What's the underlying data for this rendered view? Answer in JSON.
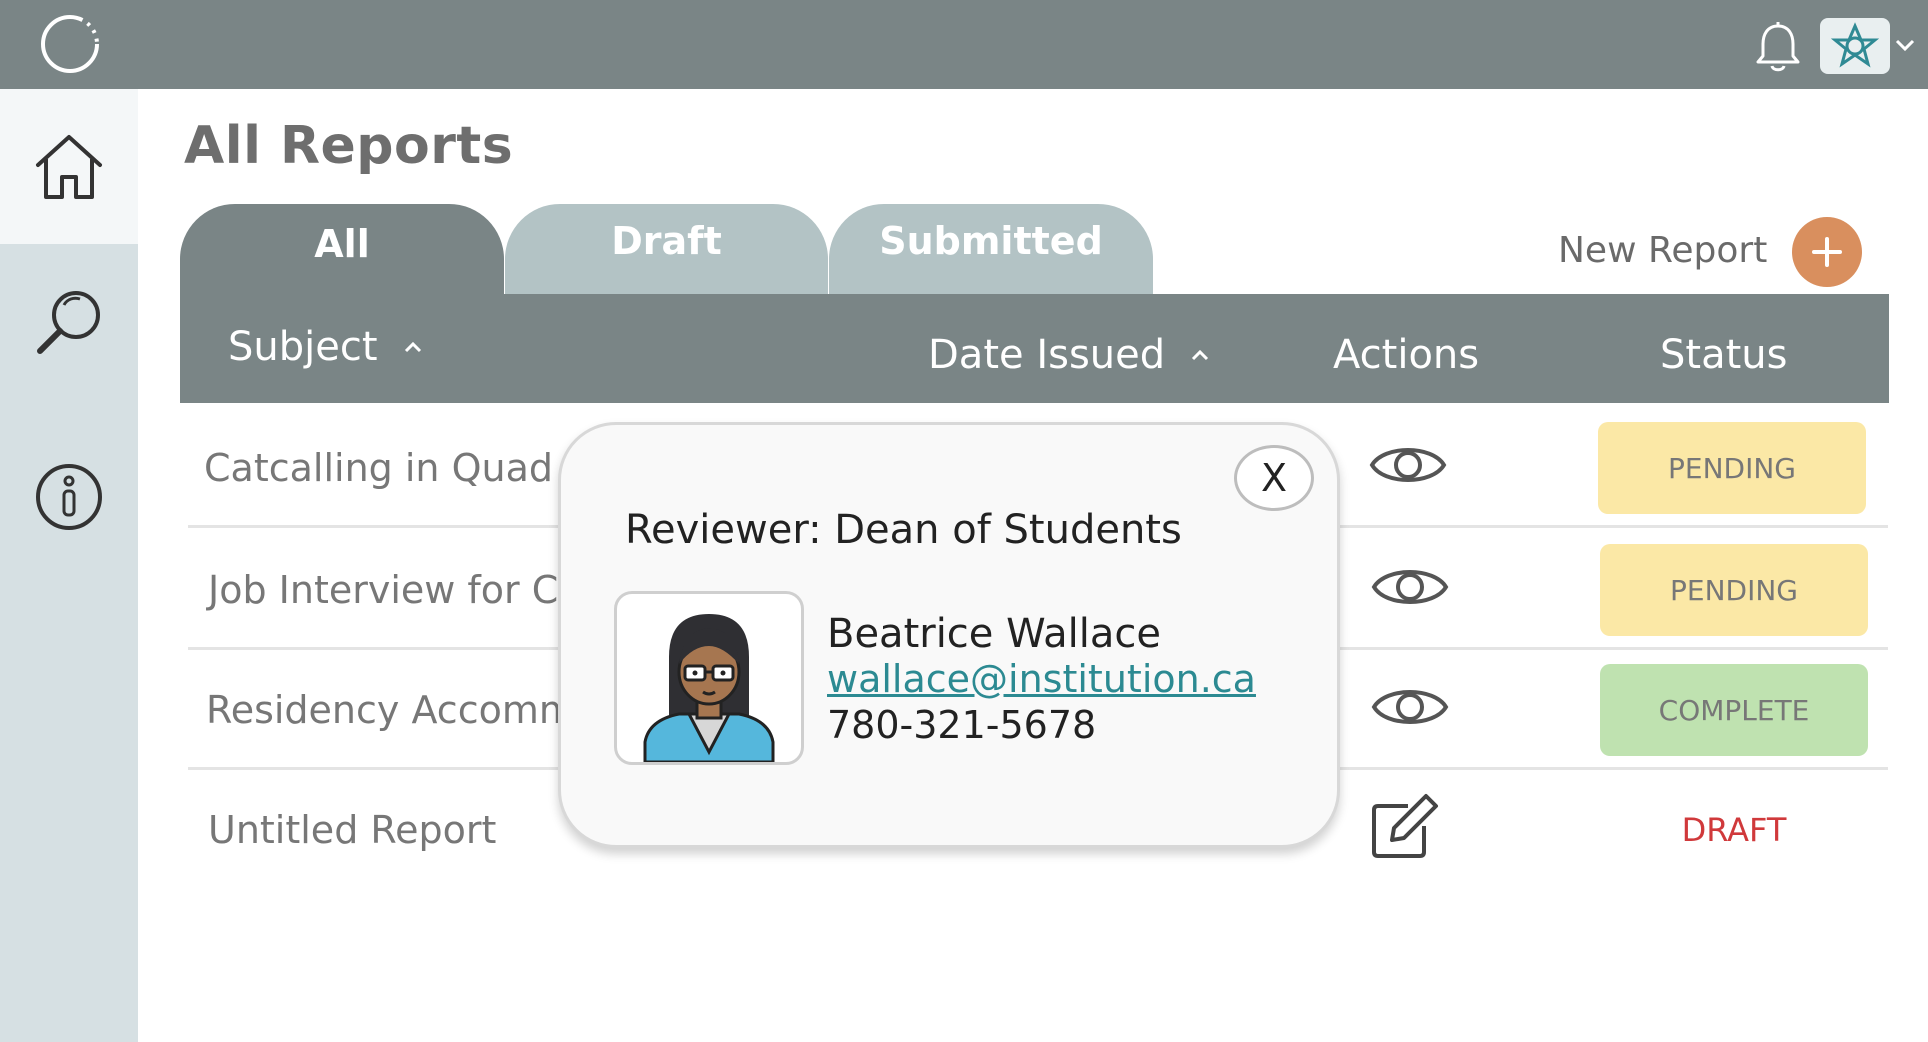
{
  "page": {
    "title": "All Reports"
  },
  "tabs": [
    {
      "label": "All",
      "active": true
    },
    {
      "label": "Draft",
      "active": false
    },
    {
      "label": "Submitted",
      "active": false
    }
  ],
  "new_report": {
    "label": "New Report"
  },
  "table": {
    "columns": {
      "subject": "Subject",
      "date_issued": "Date Issued",
      "actions": "Actions",
      "status": "Status"
    },
    "rows": [
      {
        "subject": "Catcalling in Quad",
        "action_icon": "eye-icon",
        "status": "PENDING"
      },
      {
        "subject": "Job Interview for CS",
        "action_icon": "eye-icon",
        "status": "PENDING"
      },
      {
        "subject": "Residency Accomm",
        "action_icon": "eye-icon",
        "status": "COMPLETE"
      },
      {
        "subject": "Untitled Report",
        "action_icon": "edit-icon",
        "status": "DRAFT"
      }
    ]
  },
  "popup": {
    "close_label": "X",
    "title": "Reviewer: Dean of Students",
    "name": "Beatrice Wallace",
    "email": "wallace@institution.ca",
    "phone": "780-321-5678"
  },
  "colors": {
    "header_bg": "#7a8586",
    "sidebar_bg": "#d6e0e3",
    "inactive_tab": "#b3c3c5",
    "accent_orange": "#d98f5e",
    "pending": "#fbe8a6",
    "complete": "#bfe2b0",
    "draft_text": "#d0393b",
    "link": "#2c8a92"
  }
}
